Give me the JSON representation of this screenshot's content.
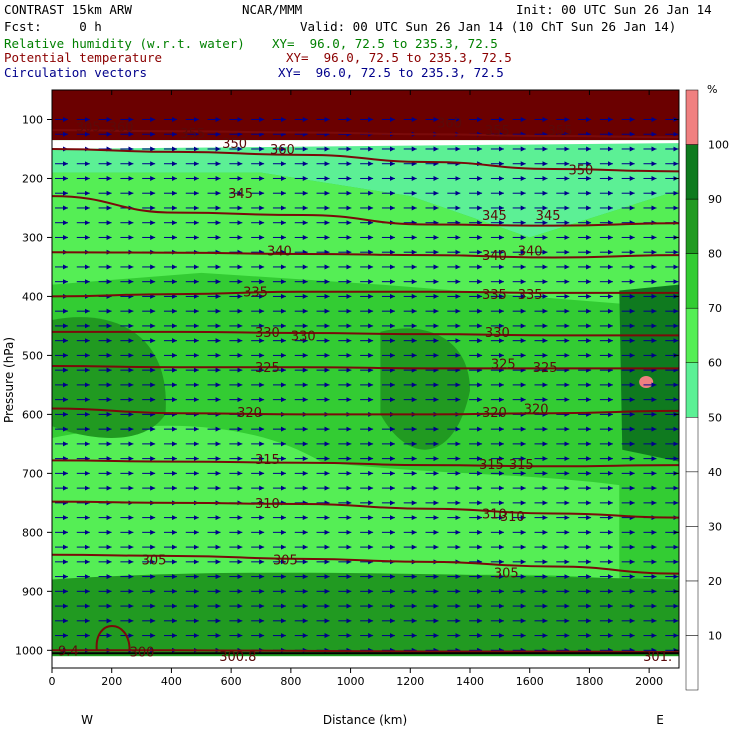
{
  "header": {
    "model": "CONTRAST 15km ARW",
    "org": "NCAR/MMM",
    "init": "Init: 00 UTC Sun 26 Jan 14",
    "fcst": "Fcst:     0 h",
    "valid": "Valid: 00 UTC Sun 26 Jan 14 (10 ChT Sun 26 Jan 14)",
    "line1_name": "Relative humidity (w.r.t. water)",
    "line1_xy": "XY=  96.0, 72.5 to 235.3, 72.5",
    "line2_name": "Potential temperature",
    "line2_xy": "XY=  96.0, 72.5 to 235.3, 72.5",
    "line3_name": "Circulation vectors",
    "line3_xy": "XY=  96.0, 72.5 to 235.3, 72.5"
  },
  "colors": {
    "rh_bands": [
      "#ffffff",
      "#ffffff",
      "#ffffff",
      "#ffffff",
      "#ffffff",
      "#5cf095",
      "#55ee55",
      "#33cc33",
      "#219a21",
      "#0f7a1f",
      "#f08080"
    ],
    "theta_contour": "#7a0a0a",
    "vector": "#00008b"
  },
  "chart_data": {
    "type": "cross-section",
    "xlabel": "Distance (km)",
    "ylabel": "Pressure (hPa)",
    "x_ticks": [
      0,
      200,
      400,
      600,
      800,
      1000,
      1200,
      1400,
      1600,
      1800,
      2000
    ],
    "y_ticks": [
      100,
      200,
      300,
      400,
      500,
      600,
      700,
      800,
      900,
      1000
    ],
    "xlim": [
      0,
      2100
    ],
    "ylim": [
      1030,
      50
    ],
    "end_labels": {
      "west": "W",
      "east": "E"
    },
    "colorbar": {
      "unit": "%",
      "levels": [
        10,
        20,
        30,
        40,
        50,
        60,
        70,
        80,
        90,
        100
      ]
    },
    "theta_contours": [
      {
        "value": 300,
        "p": [
          1000,
          1000,
          1001,
          1002,
          1002,
          1003
        ]
      },
      {
        "value": 305,
        "p": [
          838,
          840,
          845,
          850,
          858,
          870
        ]
      },
      {
        "value": 310,
        "p": [
          748,
          750,
          752,
          760,
          768,
          775
        ]
      },
      {
        "value": 315,
        "p": [
          678,
          680,
          682,
          686,
          688,
          686
        ]
      },
      {
        "value": 320,
        "p": [
          590,
          598,
          600,
          600,
          598,
          594
        ]
      },
      {
        "value": 325,
        "p": [
          518,
          520,
          520,
          522,
          522,
          522
        ]
      },
      {
        "value": 330,
        "p": [
          460,
          460,
          462,
          464,
          466,
          466
        ]
      },
      {
        "value": 335,
        "p": [
          400,
          396,
          392,
          392,
          394,
          394
        ]
      },
      {
        "value": 340,
        "p": [
          325,
          326,
          328,
          330,
          334,
          330
        ]
      },
      {
        "value": 345,
        "p": [
          230,
          258,
          262,
          278,
          280,
          276
        ]
      },
      {
        "value": 350,
        "p": [
          150,
          155,
          160,
          172,
          184,
          188
        ]
      },
      {
        "value": 355,
        "p": [
          118,
          120,
          122,
          125,
          128,
          130
        ]
      }
    ],
    "contour_labels": [
      {
        "text": "305",
        "x": 80,
        "p": 112
      },
      {
        "text": "360",
        "x": 190,
        "p": 112
      },
      {
        "text": "355",
        "x": 430,
        "p": 123
      },
      {
        "text": "350",
        "x": 570,
        "p": 140
      },
      {
        "text": "360",
        "x": 730,
        "p": 150
      },
      {
        "text": "360",
        "x": 1290,
        "p": 105
      },
      {
        "text": "355",
        "x": 1450,
        "p": 118
      },
      {
        "text": "355",
        "x": 1660,
        "p": 118
      },
      {
        "text": "350",
        "x": 1730,
        "p": 185
      },
      {
        "text": "345",
        "x": 590,
        "p": 225
      },
      {
        "text": "345",
        "x": 1440,
        "p": 262
      },
      {
        "text": "345",
        "x": 1620,
        "p": 262
      },
      {
        "text": "340",
        "x": 720,
        "p": 322
      },
      {
        "text": "340",
        "x": 1440,
        "p": 330
      },
      {
        "text": "340",
        "x": 1560,
        "p": 322
      },
      {
        "text": "335",
        "x": 640,
        "p": 392
      },
      {
        "text": "335",
        "x": 1440,
        "p": 396
      },
      {
        "text": "335",
        "x": 1560,
        "p": 396
      },
      {
        "text": "330",
        "x": 680,
        "p": 460
      },
      {
        "text": "330",
        "x": 800,
        "p": 466
      },
      {
        "text": "330",
        "x": 1450,
        "p": 460
      },
      {
        "text": "325",
        "x": 680,
        "p": 520
      },
      {
        "text": "325",
        "x": 1470,
        "p": 514
      },
      {
        "text": "325",
        "x": 1610,
        "p": 520
      },
      {
        "text": "320",
        "x": 620,
        "p": 596
      },
      {
        "text": "320",
        "x": 1440,
        "p": 596
      },
      {
        "text": "320",
        "x": 1580,
        "p": 590
      },
      {
        "text": "315",
        "x": 680,
        "p": 676
      },
      {
        "text": "315",
        "x": 1430,
        "p": 684
      },
      {
        "text": "315",
        "x": 1530,
        "p": 684
      },
      {
        "text": "310",
        "x": 680,
        "p": 750
      },
      {
        "text": "310",
        "x": 1440,
        "p": 768
      },
      {
        "text": "310",
        "x": 1500,
        "p": 772
      },
      {
        "text": "305",
        "x": 300,
        "p": 846
      },
      {
        "text": "305",
        "x": 740,
        "p": 846
      },
      {
        "text": "305",
        "x": 1480,
        "p": 868
      },
      {
        "text": "9.4",
        "x": 20,
        "p": 1000
      },
      {
        "text": "300",
        "x": 260,
        "p": 1002
      },
      {
        "text": "300.8",
        "x": 560,
        "p": 1010
      },
      {
        "text": "301.",
        "x": 1980,
        "p": 1010
      }
    ]
  }
}
